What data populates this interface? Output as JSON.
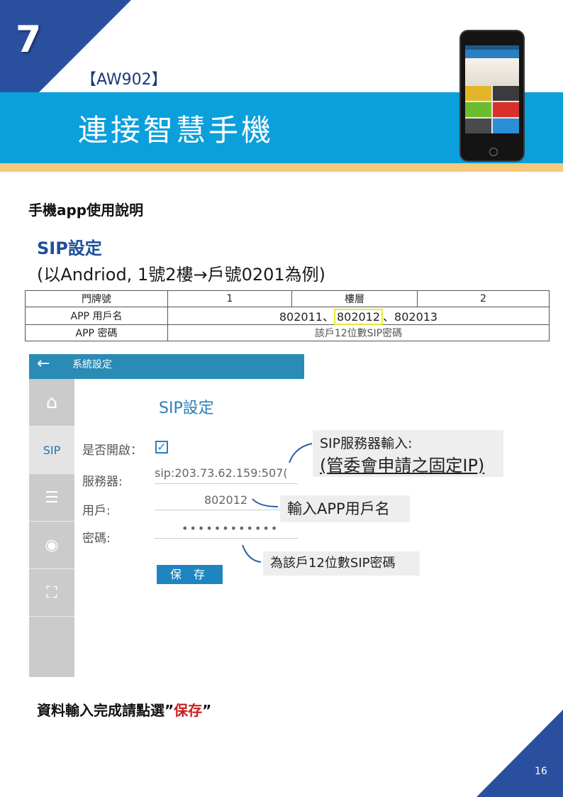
{
  "header": {
    "chapter_number": "7",
    "model_tag": "【AW902】",
    "page_title": "連接智慧手機",
    "colors": {
      "dark_blue": "#2a4f9e",
      "band_blue": "#0b9fdc",
      "band_yellow": "#f2c97d"
    }
  },
  "body": {
    "section_heading": "手機app使用說明",
    "sip_title": "SIP設定",
    "example_line": "(以Andriod, 1號2樓→戶號0201為例)"
  },
  "table": {
    "row1": {
      "label": "門牌號",
      "value1": "1",
      "label2": "樓層",
      "value2": "2"
    },
    "row2": {
      "label": "APP 用戶名",
      "part1": "802011、",
      "highlight": "802012",
      "part2": "、802013"
    },
    "row3": {
      "label": "APP 密碼",
      "value": "該戶12位數SIP密碼"
    }
  },
  "app": {
    "topbar_title": "系統設定",
    "back_icon": "←",
    "sidebar": {
      "home_icon": "⌂",
      "sip_label": "SIP",
      "sliders_icon": "☰",
      "eye_icon": "◉",
      "frame_icon": "⛶"
    },
    "screen_title": "SIP設定",
    "enable_label": "是否開啟：",
    "checkbox_mark": "✓",
    "server_label": "服務器:",
    "server_value": "sip:203.73.62.159:507(",
    "user_label": "用戶:",
    "user_value": "802012",
    "password_label": "密碼:",
    "password_value": "••••••••••••",
    "save_button": "保 存"
  },
  "callouts": {
    "server_line1": "SIP服務器輸入:",
    "server_line2": "(管委會申請之固定IP)",
    "user": "輸入APP用戶名",
    "password": "為該戶12位數SIP密碼"
  },
  "footer": {
    "note_prefix": "資料輸入完成請點選”",
    "note_save": "保存",
    "note_suffix": "”",
    "page_number": "16"
  }
}
